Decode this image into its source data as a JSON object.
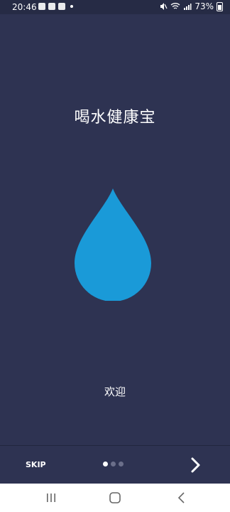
{
  "status_bar": {
    "time": "20:46",
    "battery": "73%",
    "left_icons": [
      "gallery-icon",
      "gmail-icon",
      "app-icon",
      "notification-dot"
    ],
    "right_icons": [
      "mute-icon",
      "wifi-icon",
      "signal-icon",
      "battery-icon"
    ]
  },
  "app": {
    "title": "喝水健康宝",
    "welcome": "欢迎",
    "drop_color": "#1a9ad8",
    "background_color": "#2e3352"
  },
  "onboarding": {
    "skip_label": "SKIP",
    "page_count": 3,
    "current_page": 1
  },
  "nav_bar": {
    "buttons": [
      "recent-apps",
      "home",
      "back"
    ]
  }
}
